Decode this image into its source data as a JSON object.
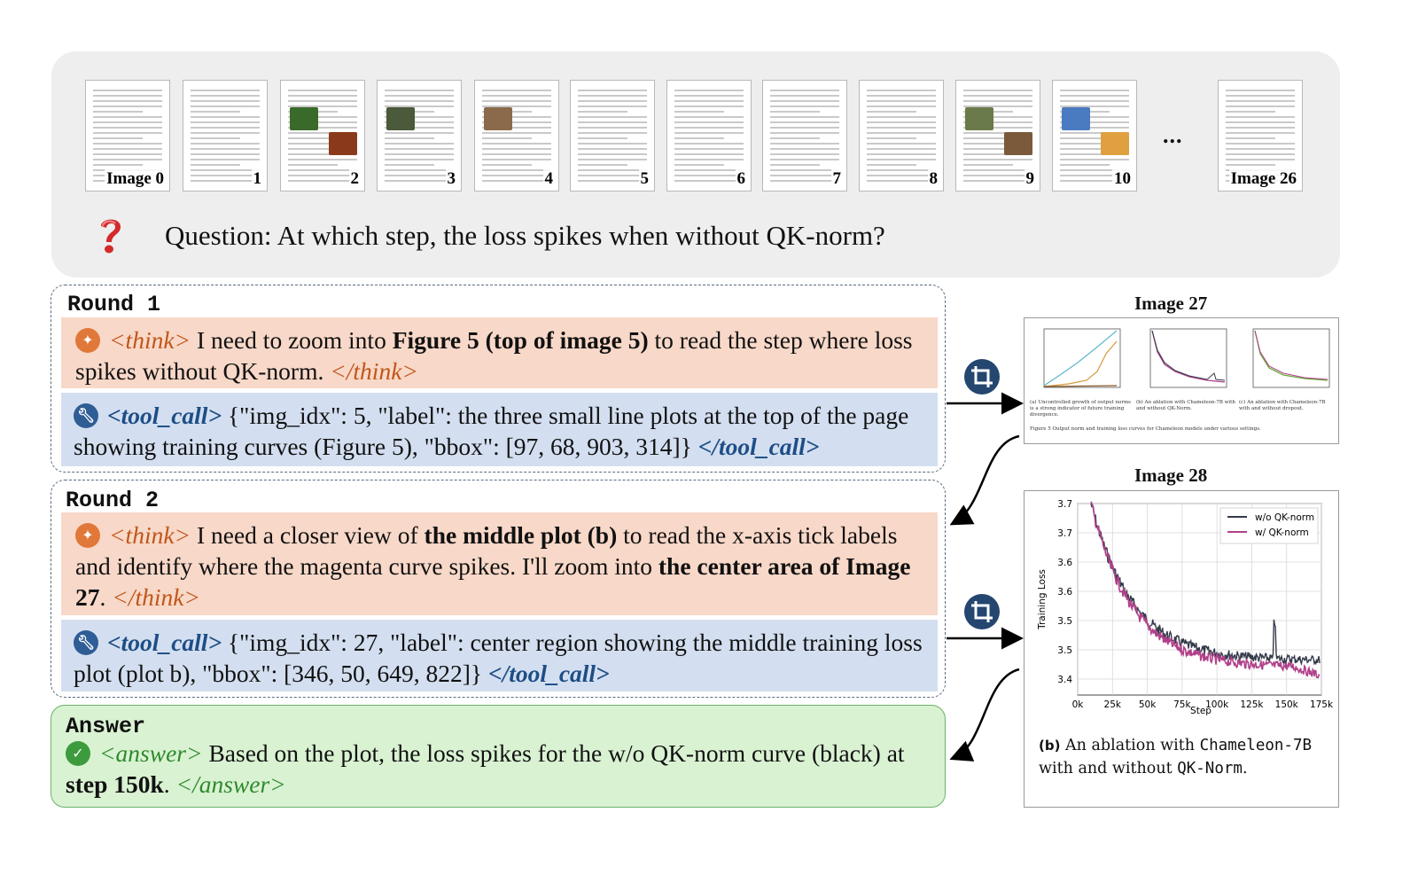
{
  "thumbnails": [
    {
      "label": "Image 0"
    },
    {
      "label": "1"
    },
    {
      "label": "2"
    },
    {
      "label": "3"
    },
    {
      "label": "4"
    },
    {
      "label": "5"
    },
    {
      "label": "6"
    },
    {
      "label": "7"
    },
    {
      "label": "8"
    },
    {
      "label": "9"
    },
    {
      "label": "10"
    },
    {
      "label": "Image 26"
    }
  ],
  "ellipsis": "...",
  "question": "Question: At which step, the loss spikes when without QK-norm?",
  "rounds": [
    {
      "title": "Round 1",
      "think_open": "<think>",
      "think_parts": [
        "I need to zoom into ",
        "Figure 5 (top of image 5)",
        " to read the step where loss spikes without QK-norm. "
      ],
      "think_close": "</think>",
      "tool_open": "<tool_call>",
      "tool_text": "{\"img_idx\": 5, \"label\": the three small line plots at the top of the page showing training curves (Figure 5), \"bbox\": [97, 68, 903, 314]}",
      "tool_close": "</tool_call>"
    },
    {
      "title": "Round 2",
      "think_open": "<think>",
      "think_parts": [
        "I need a closer view of ",
        "the middle plot (b)",
        " to read the x-axis tick labels and identify where the magenta curve spikes. I'll zoom into ",
        "the center area of Image 27",
        ". "
      ],
      "think_close": "</think>",
      "tool_open": "<tool_call>",
      "tool_text": "{\"img_idx\": 27, \"label\": center region showing the middle training loss plot (plot b), \"bbox\": [346, 50, 649, 822]}",
      "tool_close": "</tool_call>"
    }
  ],
  "answer": {
    "title": "Answer",
    "open": "<answer>",
    "parts": [
      "Based on the plot, the loss spikes for the w/o QK-norm curve (black) at ",
      "step 150k",
      ". "
    ],
    "close": "</answer>"
  },
  "image27": {
    "title": "Image 27",
    "sub_captions": [
      "(a) Uncontrolled growth of output norms is a strong indicator of future training divergence.",
      "(b) An ablation with Chameleon-7B with and without QK-Norm.",
      "(c) An ablation with Chameleon-7B with and without dropout."
    ],
    "figure_caption": "Figure 5 Output norm and training loss curves for Chameleon models under various settings."
  },
  "image28": {
    "title": "Image 28",
    "ylabel": "Training Loss",
    "xlabel": "Step",
    "yticks": [
      "3.7",
      "3.7",
      "3.6",
      "3.6",
      "3.5",
      "3.5",
      "3.4"
    ],
    "xticks": [
      "0k",
      "25k",
      "50k",
      "75k",
      "100k",
      "125k",
      "150k",
      "175k"
    ],
    "legend": [
      "w/o QK-norm",
      "w/ QK-norm"
    ],
    "caption_bold": "(b)",
    "caption_1": " An ablation with ",
    "caption_mono_1": "Chameleon-7B",
    "caption_2": " with and without ",
    "caption_mono_2": "QK-Norm",
    "caption_3": "."
  },
  "colors": {
    "black_series": "#333a4a",
    "magenta_series": "#b0408a",
    "think_bg": "#f8d8c8",
    "tool_bg": "#d3dff0",
    "answer_bg": "#d9f2d2"
  }
}
